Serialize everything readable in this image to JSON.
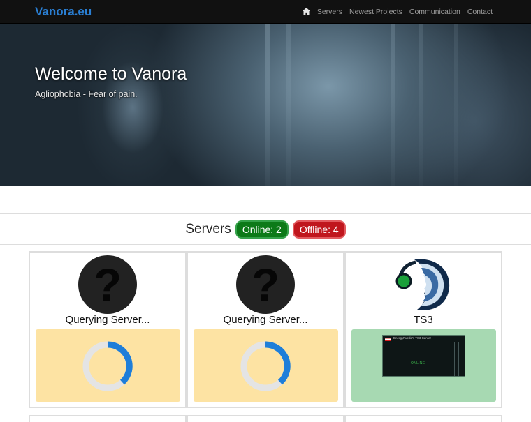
{
  "navbar": {
    "brand": "Vanora.eu",
    "items": [
      {
        "icon": "home-icon"
      },
      {
        "label": "Servers"
      },
      {
        "label": "Newest Projects"
      },
      {
        "label": "Communication"
      },
      {
        "label": "Contact"
      }
    ]
  },
  "hero": {
    "title": "Welcome to Vanora",
    "subtitle": "Agliophobia - Fear of pain."
  },
  "servers": {
    "title": "Servers",
    "online_label": "Online: 2",
    "offline_label": "Offline: 4",
    "cards": [
      {
        "title": "Querying Server...",
        "icon": "question-icon",
        "panel_color": "#fde3a3",
        "loading": true
      },
      {
        "title": "Querying Server...",
        "icon": "question-icon",
        "panel_color": "#fde3a3",
        "loading": true
      },
      {
        "title": "TS3",
        "icon": "teamspeak-icon",
        "panel_color": "#a7d9b2",
        "banner": {
          "server_name": "EnergyFuedd's TS3 Server",
          "status": "ONLINE"
        }
      }
    ]
  },
  "colors": {
    "brand": "#2a7fd4",
    "online": "#0c7a18",
    "offline": "#c0161d",
    "spinner_arc": "#1e7ed9"
  }
}
